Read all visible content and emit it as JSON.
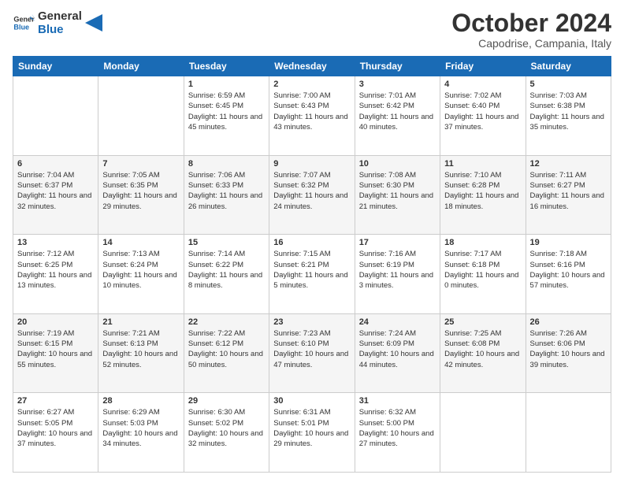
{
  "header": {
    "logo_line1": "General",
    "logo_line2": "Blue",
    "month": "October 2024",
    "location": "Capodrise, Campania, Italy"
  },
  "weekdays": [
    "Sunday",
    "Monday",
    "Tuesday",
    "Wednesday",
    "Thursday",
    "Friday",
    "Saturday"
  ],
  "weeks": [
    [
      {
        "day": "",
        "sunrise": "",
        "sunset": "",
        "daylight": ""
      },
      {
        "day": "",
        "sunrise": "",
        "sunset": "",
        "daylight": ""
      },
      {
        "day": "1",
        "sunrise": "Sunrise: 6:59 AM",
        "sunset": "Sunset: 6:45 PM",
        "daylight": "Daylight: 11 hours and 45 minutes."
      },
      {
        "day": "2",
        "sunrise": "Sunrise: 7:00 AM",
        "sunset": "Sunset: 6:43 PM",
        "daylight": "Daylight: 11 hours and 43 minutes."
      },
      {
        "day": "3",
        "sunrise": "Sunrise: 7:01 AM",
        "sunset": "Sunset: 6:42 PM",
        "daylight": "Daylight: 11 hours and 40 minutes."
      },
      {
        "day": "4",
        "sunrise": "Sunrise: 7:02 AM",
        "sunset": "Sunset: 6:40 PM",
        "daylight": "Daylight: 11 hours and 37 minutes."
      },
      {
        "day": "5",
        "sunrise": "Sunrise: 7:03 AM",
        "sunset": "Sunset: 6:38 PM",
        "daylight": "Daylight: 11 hours and 35 minutes."
      }
    ],
    [
      {
        "day": "6",
        "sunrise": "Sunrise: 7:04 AM",
        "sunset": "Sunset: 6:37 PM",
        "daylight": "Daylight: 11 hours and 32 minutes."
      },
      {
        "day": "7",
        "sunrise": "Sunrise: 7:05 AM",
        "sunset": "Sunset: 6:35 PM",
        "daylight": "Daylight: 11 hours and 29 minutes."
      },
      {
        "day": "8",
        "sunrise": "Sunrise: 7:06 AM",
        "sunset": "Sunset: 6:33 PM",
        "daylight": "Daylight: 11 hours and 26 minutes."
      },
      {
        "day": "9",
        "sunrise": "Sunrise: 7:07 AM",
        "sunset": "Sunset: 6:32 PM",
        "daylight": "Daylight: 11 hours and 24 minutes."
      },
      {
        "day": "10",
        "sunrise": "Sunrise: 7:08 AM",
        "sunset": "Sunset: 6:30 PM",
        "daylight": "Daylight: 11 hours and 21 minutes."
      },
      {
        "day": "11",
        "sunrise": "Sunrise: 7:10 AM",
        "sunset": "Sunset: 6:28 PM",
        "daylight": "Daylight: 11 hours and 18 minutes."
      },
      {
        "day": "12",
        "sunrise": "Sunrise: 7:11 AM",
        "sunset": "Sunset: 6:27 PM",
        "daylight": "Daylight: 11 hours and 16 minutes."
      }
    ],
    [
      {
        "day": "13",
        "sunrise": "Sunrise: 7:12 AM",
        "sunset": "Sunset: 6:25 PM",
        "daylight": "Daylight: 11 hours and 13 minutes."
      },
      {
        "day": "14",
        "sunrise": "Sunrise: 7:13 AM",
        "sunset": "Sunset: 6:24 PM",
        "daylight": "Daylight: 11 hours and 10 minutes."
      },
      {
        "day": "15",
        "sunrise": "Sunrise: 7:14 AM",
        "sunset": "Sunset: 6:22 PM",
        "daylight": "Daylight: 11 hours and 8 minutes."
      },
      {
        "day": "16",
        "sunrise": "Sunrise: 7:15 AM",
        "sunset": "Sunset: 6:21 PM",
        "daylight": "Daylight: 11 hours and 5 minutes."
      },
      {
        "day": "17",
        "sunrise": "Sunrise: 7:16 AM",
        "sunset": "Sunset: 6:19 PM",
        "daylight": "Daylight: 11 hours and 3 minutes."
      },
      {
        "day": "18",
        "sunrise": "Sunrise: 7:17 AM",
        "sunset": "Sunset: 6:18 PM",
        "daylight": "Daylight: 11 hours and 0 minutes."
      },
      {
        "day": "19",
        "sunrise": "Sunrise: 7:18 AM",
        "sunset": "Sunset: 6:16 PM",
        "daylight": "Daylight: 10 hours and 57 minutes."
      }
    ],
    [
      {
        "day": "20",
        "sunrise": "Sunrise: 7:19 AM",
        "sunset": "Sunset: 6:15 PM",
        "daylight": "Daylight: 10 hours and 55 minutes."
      },
      {
        "day": "21",
        "sunrise": "Sunrise: 7:21 AM",
        "sunset": "Sunset: 6:13 PM",
        "daylight": "Daylight: 10 hours and 52 minutes."
      },
      {
        "day": "22",
        "sunrise": "Sunrise: 7:22 AM",
        "sunset": "Sunset: 6:12 PM",
        "daylight": "Daylight: 10 hours and 50 minutes."
      },
      {
        "day": "23",
        "sunrise": "Sunrise: 7:23 AM",
        "sunset": "Sunset: 6:10 PM",
        "daylight": "Daylight: 10 hours and 47 minutes."
      },
      {
        "day": "24",
        "sunrise": "Sunrise: 7:24 AM",
        "sunset": "Sunset: 6:09 PM",
        "daylight": "Daylight: 10 hours and 44 minutes."
      },
      {
        "day": "25",
        "sunrise": "Sunrise: 7:25 AM",
        "sunset": "Sunset: 6:08 PM",
        "daylight": "Daylight: 10 hours and 42 minutes."
      },
      {
        "day": "26",
        "sunrise": "Sunrise: 7:26 AM",
        "sunset": "Sunset: 6:06 PM",
        "daylight": "Daylight: 10 hours and 39 minutes."
      }
    ],
    [
      {
        "day": "27",
        "sunrise": "Sunrise: 6:27 AM",
        "sunset": "Sunset: 5:05 PM",
        "daylight": "Daylight: 10 hours and 37 minutes."
      },
      {
        "day": "28",
        "sunrise": "Sunrise: 6:29 AM",
        "sunset": "Sunset: 5:03 PM",
        "daylight": "Daylight: 10 hours and 34 minutes."
      },
      {
        "day": "29",
        "sunrise": "Sunrise: 6:30 AM",
        "sunset": "Sunset: 5:02 PM",
        "daylight": "Daylight: 10 hours and 32 minutes."
      },
      {
        "day": "30",
        "sunrise": "Sunrise: 6:31 AM",
        "sunset": "Sunset: 5:01 PM",
        "daylight": "Daylight: 10 hours and 29 minutes."
      },
      {
        "day": "31",
        "sunrise": "Sunrise: 6:32 AM",
        "sunset": "Sunset: 5:00 PM",
        "daylight": "Daylight: 10 hours and 27 minutes."
      },
      {
        "day": "",
        "sunrise": "",
        "sunset": "",
        "daylight": ""
      },
      {
        "day": "",
        "sunrise": "",
        "sunset": "",
        "daylight": ""
      }
    ]
  ]
}
